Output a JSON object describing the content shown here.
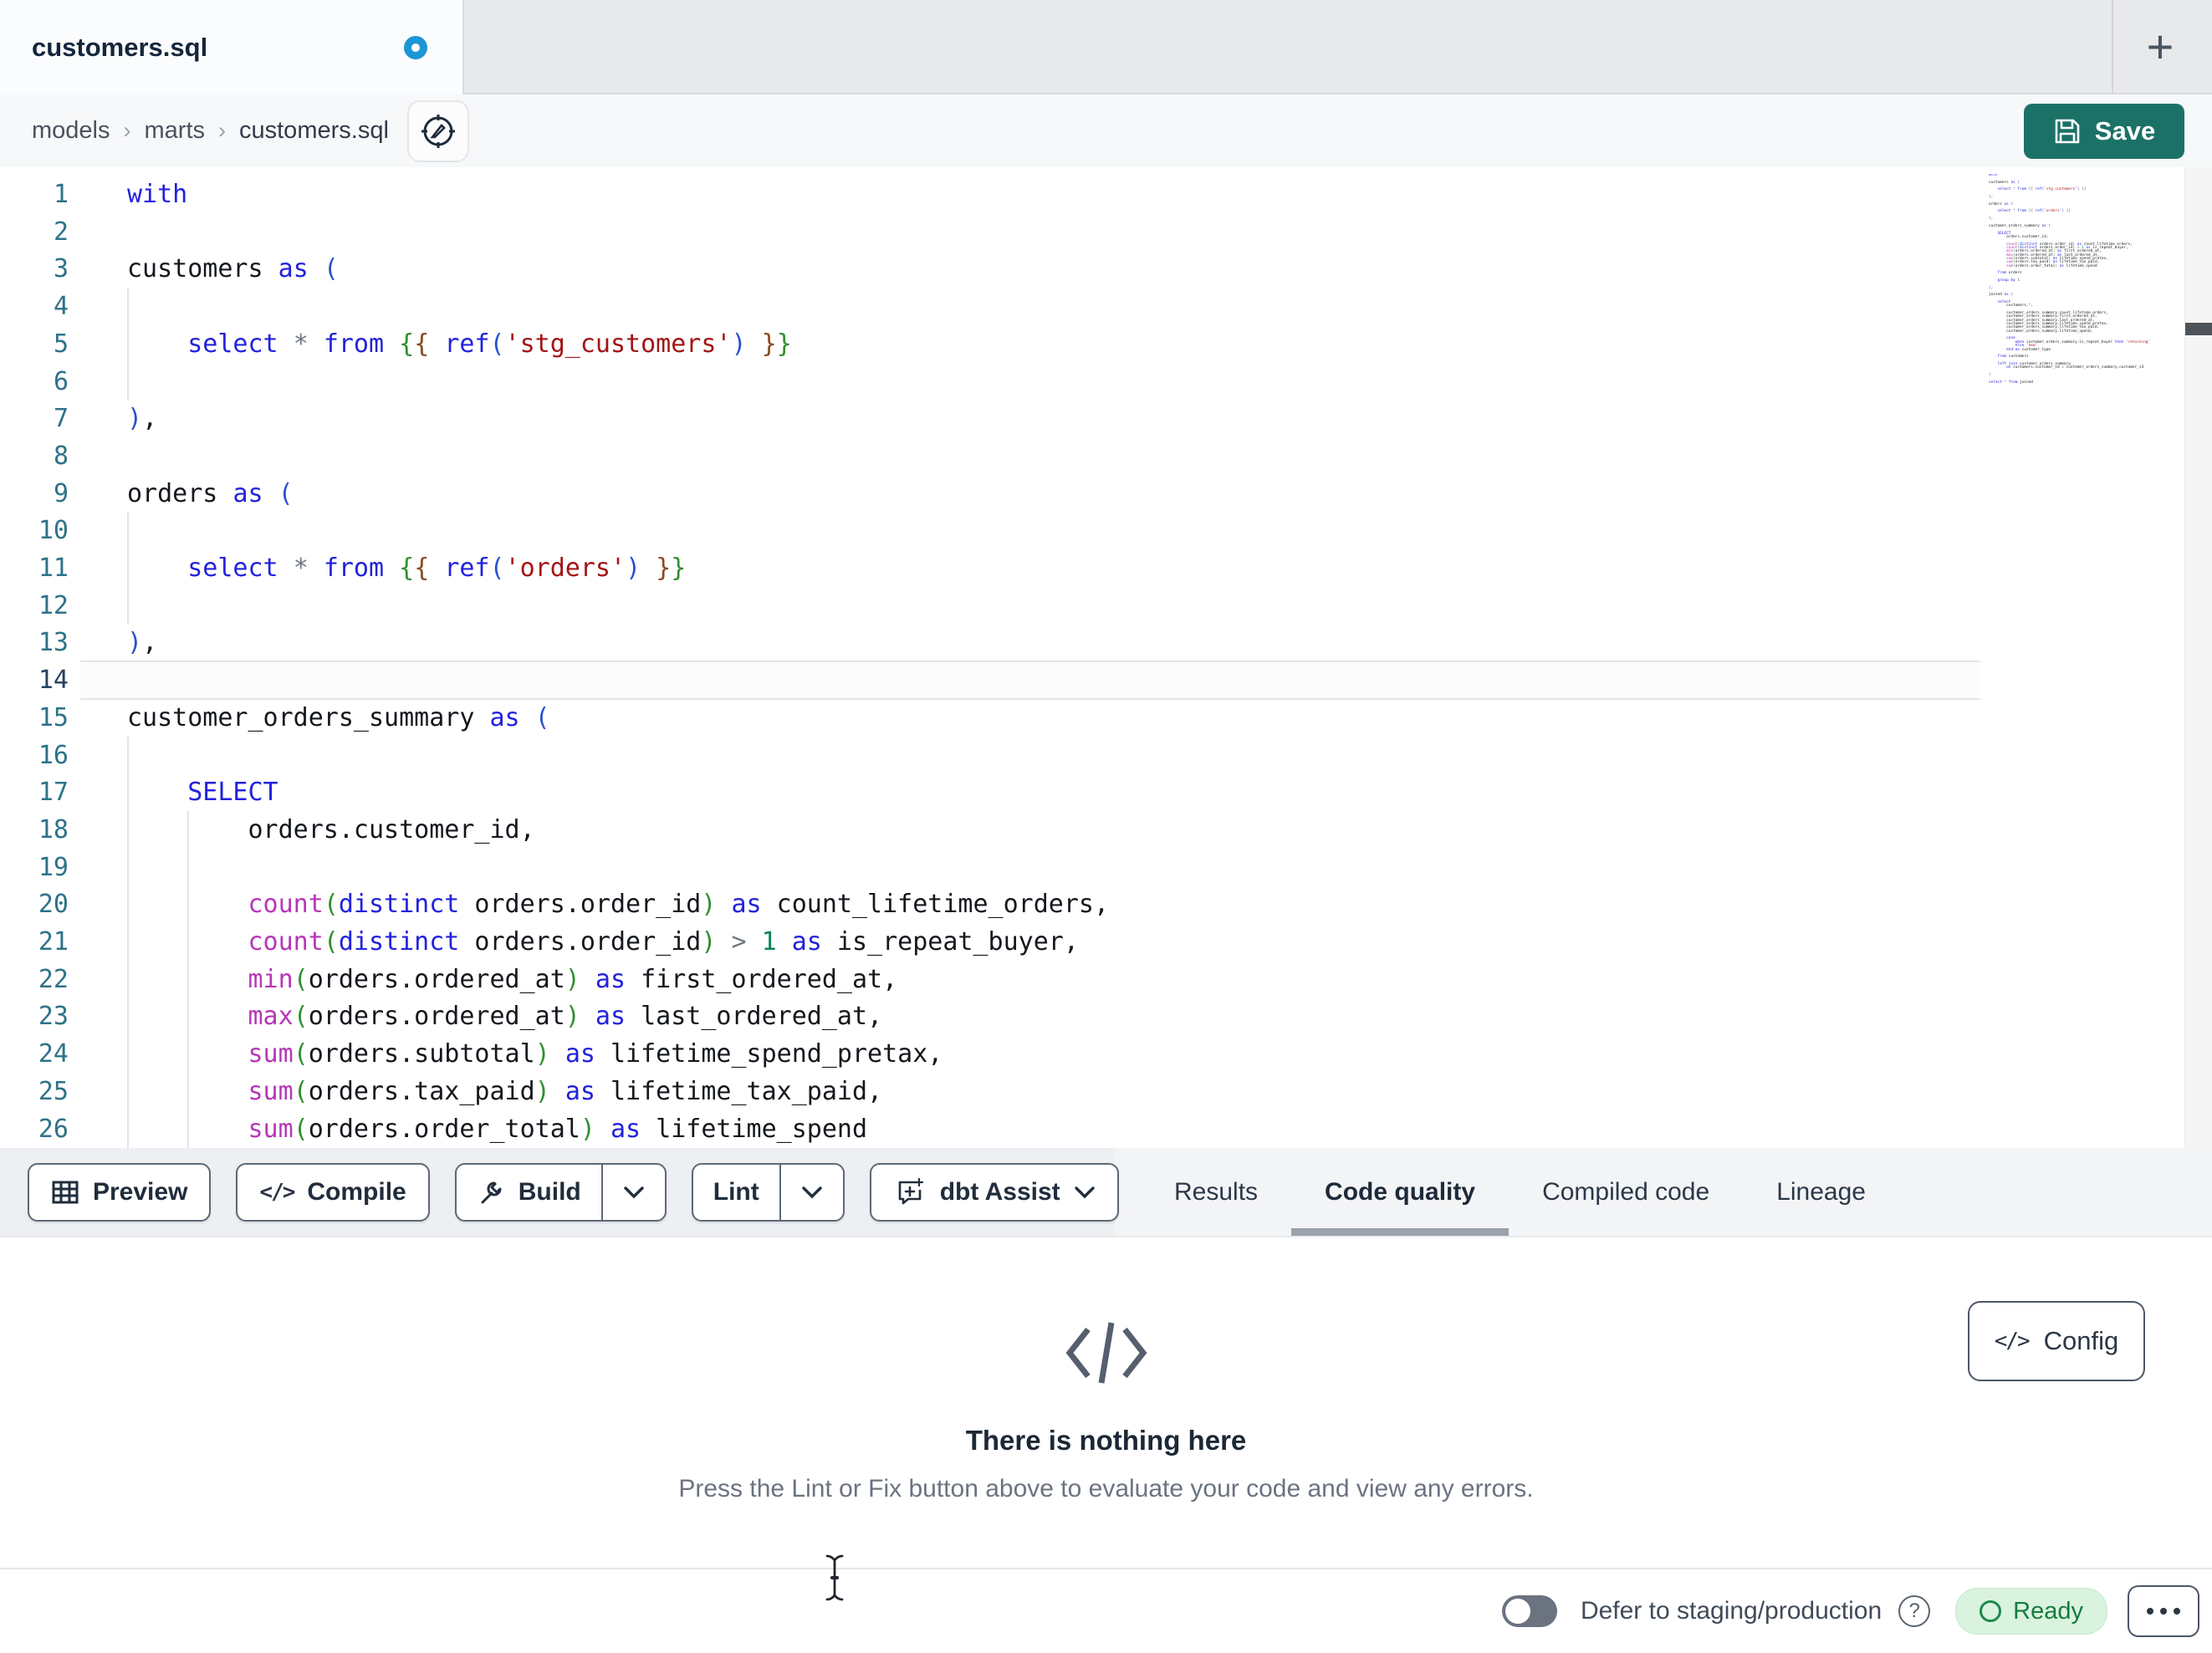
{
  "colors": {
    "k": "#2222dd",
    "p": "#14181d",
    "o": "#6f7680",
    "s": "#a31515",
    "n": "#0a8658",
    "f": "#b836b8",
    "b1": "#2b50cc",
    "b2": "#2f8f2f",
    "b3": "#8a4a21",
    "ln": "#2d7389",
    "lnact": "#27425f",
    "accent_save": "#1c7167",
    "unsaved_dot": "#1b96d4",
    "ready_green": "#177b3f",
    "active_underline": "#99a1ab"
  },
  "tab_bar": {
    "title": "customers.sql",
    "new_tab_label": "+"
  },
  "breadcrumb": {
    "items": [
      "models",
      "marts",
      "customers.sql"
    ],
    "separator": "›"
  },
  "save_button": {
    "label": "Save"
  },
  "editor": {
    "active_line": 14,
    "guides": {
      "4": [
        0
      ],
      "5": [
        0
      ],
      "6": [
        0
      ],
      "10": [
        0
      ],
      "11": [
        0
      ],
      "12": [
        0
      ],
      "16": [
        0
      ],
      "17": [
        0
      ],
      "18": [
        0,
        1
      ],
      "19": [
        0,
        1
      ],
      "20": [
        0,
        1
      ],
      "21": [
        0,
        1
      ],
      "22": [
        0,
        1
      ],
      "23": [
        0,
        1
      ],
      "24": [
        0,
        1
      ],
      "25": [
        0,
        1
      ],
      "26": [
        0,
        1
      ]
    },
    "lines": [
      {
        "n": 1,
        "tok": [
          [
            "k",
            "with"
          ]
        ]
      },
      {
        "n": 2,
        "tok": []
      },
      {
        "n": 3,
        "tok": [
          [
            "p",
            "customers "
          ],
          [
            "k",
            "as"
          ],
          [
            "p",
            " "
          ],
          [
            "b1",
            "("
          ]
        ]
      },
      {
        "n": 4,
        "tok": []
      },
      {
        "n": 5,
        "tok": [
          [
            "p",
            "    "
          ],
          [
            "k",
            "select"
          ],
          [
            "p",
            " "
          ],
          [
            "o",
            "*"
          ],
          [
            "p",
            " "
          ],
          [
            "k",
            "from"
          ],
          [
            "p",
            " "
          ],
          [
            "b2",
            "{"
          ],
          [
            "b3",
            "{"
          ],
          [
            "p",
            " "
          ],
          [
            "k",
            "ref"
          ],
          [
            "b1",
            "("
          ],
          [
            "s",
            "'stg_customers'"
          ],
          [
            "b1",
            ")"
          ],
          [
            "p",
            " "
          ],
          [
            "b3",
            "}"
          ],
          [
            "b2",
            "}"
          ]
        ]
      },
      {
        "n": 6,
        "tok": []
      },
      {
        "n": 7,
        "tok": [
          [
            "b1",
            ")"
          ],
          [
            "p",
            ","
          ]
        ]
      },
      {
        "n": 8,
        "tok": []
      },
      {
        "n": 9,
        "tok": [
          [
            "p",
            "orders "
          ],
          [
            "k",
            "as"
          ],
          [
            "p",
            " "
          ],
          [
            "b1",
            "("
          ]
        ]
      },
      {
        "n": 10,
        "tok": []
      },
      {
        "n": 11,
        "tok": [
          [
            "p",
            "    "
          ],
          [
            "k",
            "select"
          ],
          [
            "p",
            " "
          ],
          [
            "o",
            "*"
          ],
          [
            "p",
            " "
          ],
          [
            "k",
            "from"
          ],
          [
            "p",
            " "
          ],
          [
            "b2",
            "{"
          ],
          [
            "b3",
            "{"
          ],
          [
            "p",
            " "
          ],
          [
            "k",
            "ref"
          ],
          [
            "b1",
            "("
          ],
          [
            "s",
            "'orders'"
          ],
          [
            "b1",
            ")"
          ],
          [
            "p",
            " "
          ],
          [
            "b3",
            "}"
          ],
          [
            "b2",
            "}"
          ]
        ]
      },
      {
        "n": 12,
        "tok": []
      },
      {
        "n": 13,
        "tok": [
          [
            "b1",
            ")"
          ],
          [
            "p",
            ","
          ]
        ]
      },
      {
        "n": 14,
        "tok": []
      },
      {
        "n": 15,
        "tok": [
          [
            "p",
            "customer_orders_summary "
          ],
          [
            "k",
            "as"
          ],
          [
            "p",
            " "
          ],
          [
            "b1",
            "("
          ]
        ]
      },
      {
        "n": 16,
        "tok": []
      },
      {
        "n": 17,
        "tok": [
          [
            "p",
            "    "
          ],
          [
            "k",
            "SELECT"
          ]
        ]
      },
      {
        "n": 18,
        "tok": [
          [
            "p",
            "        orders.customer_id,"
          ]
        ]
      },
      {
        "n": 19,
        "tok": []
      },
      {
        "n": 20,
        "tok": [
          [
            "p",
            "        "
          ],
          [
            "f",
            "count"
          ],
          [
            "b2",
            "("
          ],
          [
            "k",
            "distinct"
          ],
          [
            "p",
            " orders.order_id"
          ],
          [
            "b2",
            ")"
          ],
          [
            "p",
            " "
          ],
          [
            "k",
            "as"
          ],
          [
            "p",
            " count_lifetime_orders,"
          ]
        ]
      },
      {
        "n": 21,
        "tok": [
          [
            "p",
            "        "
          ],
          [
            "f",
            "count"
          ],
          [
            "b2",
            "("
          ],
          [
            "k",
            "distinct"
          ],
          [
            "p",
            " orders.order_id"
          ],
          [
            "b2",
            ")"
          ],
          [
            "p",
            " "
          ],
          [
            "o",
            ">"
          ],
          [
            "p",
            " "
          ],
          [
            "n",
            "1"
          ],
          [
            "p",
            " "
          ],
          [
            "k",
            "as"
          ],
          [
            "p",
            " is_repeat_buyer,"
          ]
        ]
      },
      {
        "n": 22,
        "tok": [
          [
            "p",
            "        "
          ],
          [
            "f",
            "min"
          ],
          [
            "b2",
            "("
          ],
          [
            "p",
            "orders.ordered_at"
          ],
          [
            "b2",
            ")"
          ],
          [
            "p",
            " "
          ],
          [
            "k",
            "as"
          ],
          [
            "p",
            " first_ordered_at,"
          ]
        ]
      },
      {
        "n": 23,
        "tok": [
          [
            "p",
            "        "
          ],
          [
            "f",
            "max"
          ],
          [
            "b2",
            "("
          ],
          [
            "p",
            "orders.ordered_at"
          ],
          [
            "b2",
            ")"
          ],
          [
            "p",
            " "
          ],
          [
            "k",
            "as"
          ],
          [
            "p",
            " last_ordered_at,"
          ]
        ]
      },
      {
        "n": 24,
        "tok": [
          [
            "p",
            "        "
          ],
          [
            "f",
            "sum"
          ],
          [
            "b2",
            "("
          ],
          [
            "p",
            "orders.subtotal"
          ],
          [
            "b2",
            ")"
          ],
          [
            "p",
            " "
          ],
          [
            "k",
            "as"
          ],
          [
            "p",
            " lifetime_spend_pretax,"
          ]
        ]
      },
      {
        "n": 25,
        "tok": [
          [
            "p",
            "        "
          ],
          [
            "f",
            "sum"
          ],
          [
            "b2",
            "("
          ],
          [
            "p",
            "orders.tax_paid"
          ],
          [
            "b2",
            ")"
          ],
          [
            "p",
            " "
          ],
          [
            "k",
            "as"
          ],
          [
            "p",
            " lifetime_tax_paid,"
          ]
        ]
      },
      {
        "n": 26,
        "tok": [
          [
            "p",
            "        "
          ],
          [
            "f",
            "sum"
          ],
          [
            "b2",
            "("
          ],
          [
            "p",
            "orders.order_total"
          ],
          [
            "b2",
            ")"
          ],
          [
            "p",
            " "
          ],
          [
            "k",
            "as"
          ],
          [
            "p",
            " lifetime_spend"
          ]
        ]
      }
    ],
    "minimap_extra": [
      {
        "tok": []
      },
      {
        "tok": [
          [
            "p",
            "    "
          ],
          [
            "k",
            "from"
          ],
          [
            "p",
            " orders"
          ]
        ]
      },
      {
        "tok": []
      },
      {
        "tok": [
          [
            "p",
            "    "
          ],
          [
            "k",
            "group by"
          ],
          [
            "p",
            " "
          ],
          [
            "n",
            "1"
          ]
        ]
      },
      {
        "tok": []
      },
      {
        "tok": [
          [
            "b1",
            ")"
          ],
          [
            "p",
            ","
          ]
        ]
      },
      {
        "tok": []
      },
      {
        "tok": [
          [
            "p",
            "joined "
          ],
          [
            "k",
            "as"
          ],
          [
            "p",
            " "
          ],
          [
            "b1",
            "("
          ]
        ]
      },
      {
        "tok": []
      },
      {
        "tok": [
          [
            "p",
            "    "
          ],
          [
            "k",
            "select"
          ]
        ]
      },
      {
        "tok": [
          [
            "p",
            "        customers."
          ],
          [
            "o",
            "*"
          ],
          [
            "p",
            ","
          ]
        ]
      },
      {
        "tok": []
      },
      {
        "tok": [
          [
            "p",
            "        customer_orders_summary.count_lifetime_orders,"
          ]
        ]
      },
      {
        "tok": [
          [
            "p",
            "        customer_orders_summary.first_ordered_at,"
          ]
        ]
      },
      {
        "tok": [
          [
            "p",
            "        customer_orders_summary.last_ordered_at,"
          ]
        ]
      },
      {
        "tok": [
          [
            "p",
            "        customer_orders_summary.lifetime_spend_pretax,"
          ]
        ]
      },
      {
        "tok": [
          [
            "p",
            "        customer_orders_summary.lifetime_tax_paid,"
          ]
        ]
      },
      {
        "tok": [
          [
            "p",
            "        customer_orders_summary.lifetime_spend,"
          ]
        ]
      },
      {
        "tok": []
      },
      {
        "tok": [
          [
            "p",
            "        "
          ],
          [
            "k",
            "case"
          ]
        ]
      },
      {
        "tok": [
          [
            "p",
            "            "
          ],
          [
            "k",
            "when"
          ],
          [
            "p",
            " customer_orders_summary.is_repeat_buyer "
          ],
          [
            "k",
            "then"
          ],
          [
            "p",
            " "
          ],
          [
            "s",
            "'returning'"
          ]
        ]
      },
      {
        "tok": [
          [
            "p",
            "            "
          ],
          [
            "k",
            "else"
          ],
          [
            "p",
            " "
          ],
          [
            "s",
            "'new'"
          ]
        ]
      },
      {
        "tok": [
          [
            "p",
            "        "
          ],
          [
            "k",
            "end"
          ],
          [
            "p",
            " "
          ],
          [
            "k",
            "as"
          ],
          [
            "p",
            " customer_type"
          ]
        ]
      },
      {
        "tok": []
      },
      {
        "tok": [
          [
            "p",
            "    "
          ],
          [
            "k",
            "from"
          ],
          [
            "p",
            " customers"
          ]
        ]
      },
      {
        "tok": []
      },
      {
        "tok": [
          [
            "p",
            "    "
          ],
          [
            "k",
            "left join"
          ],
          [
            "p",
            " customer_orders_summary"
          ]
        ]
      },
      {
        "tok": [
          [
            "p",
            "        "
          ],
          [
            "k",
            "on"
          ],
          [
            "p",
            " customers.customer_id "
          ],
          [
            "o",
            "="
          ],
          [
            "p",
            " customer_orders_summary.customer_id"
          ]
        ]
      },
      {
        "tok": []
      },
      {
        "tok": [
          [
            "b1",
            ")"
          ]
        ]
      },
      {
        "tok": []
      },
      {
        "tok": [
          [
            "k",
            "select"
          ],
          [
            "p",
            " "
          ],
          [
            "o",
            "*"
          ],
          [
            "p",
            " "
          ],
          [
            "k",
            "from"
          ],
          [
            "p",
            " joined"
          ]
        ]
      }
    ]
  },
  "toolbar": {
    "preview_label": "Preview",
    "compile_label": "Compile",
    "compile_glyph": "</>",
    "build_label": "Build",
    "lint_label": "Lint",
    "dbt_assist_label": "dbt Assist"
  },
  "result_tabs": [
    {
      "label": "Results",
      "active": false
    },
    {
      "label": "Code quality",
      "active": true
    },
    {
      "label": "Compiled code",
      "active": false
    },
    {
      "label": "Lineage",
      "active": false
    }
  ],
  "empty_state": {
    "title": "There is nothing here",
    "description": "Press the Lint or Fix button above to evaluate your code and view any errors."
  },
  "config_button": {
    "label": "Config",
    "glyph": "</>"
  },
  "status_bar": {
    "defer_label": "Defer to staging/production",
    "toggle_state": "off",
    "ready_label": "Ready",
    "help_glyph": "?"
  }
}
